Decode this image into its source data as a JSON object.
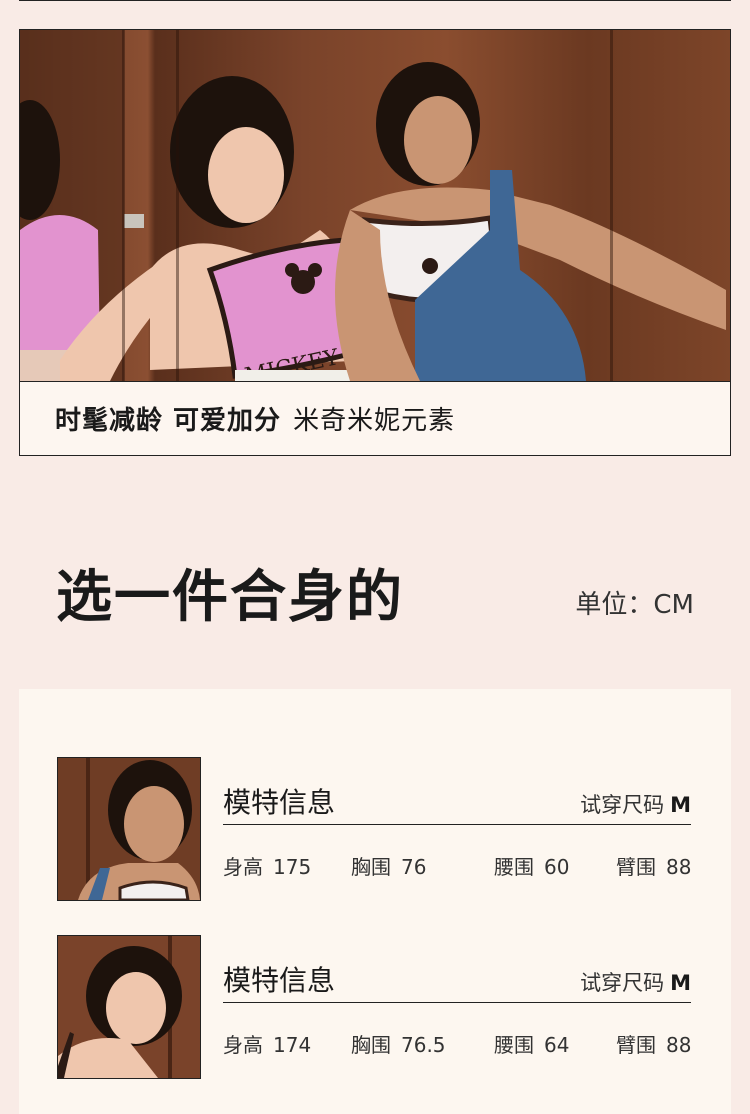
{
  "hero": {
    "caption_bold": "时髦减龄 可爱加分",
    "caption_normal": "米奇米妮元素",
    "print_text": "MICKEY MO"
  },
  "section": {
    "title": "选一件合身的",
    "unit": "单位：CM"
  },
  "models": [
    {
      "title": "模特信息",
      "size_label": "试穿尺码",
      "size_value": "M",
      "height_label": "身高",
      "height": "175",
      "bust_label": "胸围",
      "bust": "76",
      "waist_label": "腰围",
      "waist": "60",
      "arm_label": "臂围",
      "arm": "88"
    },
    {
      "title": "模特信息",
      "size_label": "试穿尺码",
      "size_value": "M",
      "height_label": "身高",
      "height": "174",
      "bust_label": "胸围",
      "bust": "76.5",
      "waist_label": "腰围",
      "waist": "64",
      "arm_label": "臂围",
      "arm": "88"
    }
  ],
  "colors": {
    "page_bg": "#f9ebe6",
    "panel_bg": "#fdf7f0",
    "pink_top": "#e58fd0",
    "white_top": "#f3efee",
    "denim": "#3f6795",
    "wood": "#7a432a"
  }
}
